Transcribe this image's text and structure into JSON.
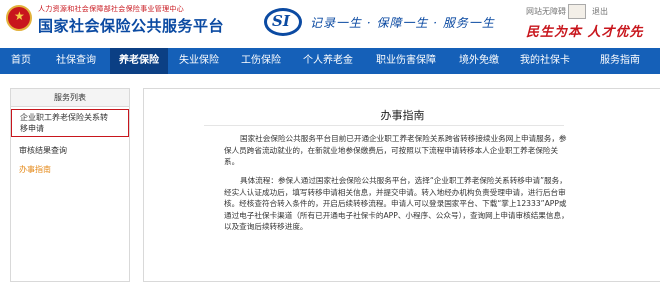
{
  "header": {
    "sub_title": "人力资源和社会保障部社会保险事业管理中心",
    "title": "国家社会保险公共服务平台",
    "si_logo_text": "SI",
    "slogan": "记录一生 · 保障一生 · 服务一生",
    "user_name": "网站无障碍",
    "logout": "退出",
    "motto": "民生为本 人才优先"
  },
  "nav": {
    "items": [
      {
        "label": "首页"
      },
      {
        "label": "社保查询"
      },
      {
        "label": "养老保险"
      },
      {
        "label": "失业保险"
      },
      {
        "label": "工伤保险"
      },
      {
        "label": "个人养老金"
      },
      {
        "label": "职业伤害保障"
      },
      {
        "label": "境外免缴"
      },
      {
        "label": "我的社保卡"
      },
      {
        "label": "服务指南"
      }
    ],
    "active_index": 2
  },
  "sidebar": {
    "heading": "服务列表",
    "items": [
      {
        "label_line1": "企业职工养老保险关系转",
        "label_line2": "移申请"
      },
      {
        "label": "审核结果查询"
      },
      {
        "label": "办事指南"
      }
    ]
  },
  "content": {
    "title": "办事指南",
    "paragraph1": "国家社会保险公共服务平台目前已开通企业职工养老保险关系跨省转移接续业务网上申请服务，参保人员跨省流动就业的，在新就业地参保缴费后，可按照以下流程申请转移本人企业职工养老保险关系。",
    "paragraph2": "具体流程：参保人通过国家社会保险公共服务平台，选择“企业职工养老保险关系转移申请”服务，经实人认证成功后，填写转移申请相关信息，并提交申请。转入地经办机构负责受理申请，进行后台审核。经核查符合转入条件的，开启后续转移流程。申请人可以登录国家平台、下载“掌上12333”APP或通过电子社保卡渠道（所有已开通电子社保卡的APP、小程序、公众号），查询网上申请审核结果信息，以及查询后续转移进度。"
  },
  "colors": {
    "brand_blue": "#1560b8",
    "nav_active": "#0b3f84",
    "title_blue": "#0b4aa2",
    "accent_red": "#c8161d",
    "link_orange": "#e58a19"
  }
}
